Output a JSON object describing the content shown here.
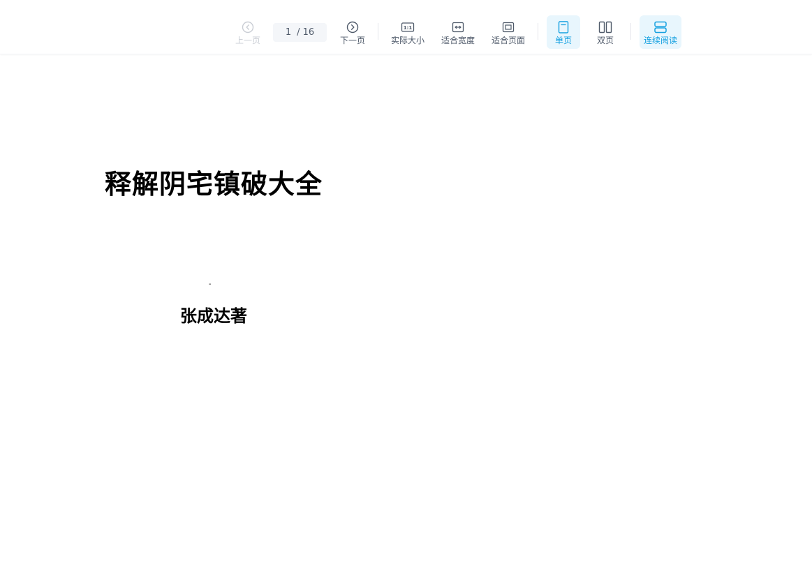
{
  "toolbar": {
    "prev_label": "上一页",
    "next_label": "下一页",
    "page_current": "1",
    "page_total": "/ 16",
    "actual_size_label": "实际大小",
    "fit_width_label": "适合宽度",
    "fit_page_label": "适合页面",
    "single_page_label": "单页",
    "double_page_label": "双页",
    "continuous_label": "连续阅读",
    "icons": {
      "prev": "chevron-left-circle-icon",
      "next": "chevron-right-circle-icon",
      "actual_size": "one-to-one-icon",
      "fit_width": "fit-width-icon",
      "fit_page": "fit-page-icon",
      "single_page": "single-page-icon",
      "double_page": "double-page-icon",
      "continuous": "continuous-scroll-icon"
    },
    "active_color": "#14a0e0",
    "active_bg": "#e8f6fd",
    "disabled_color": "#c9cdd4"
  },
  "document": {
    "title": "释解阴宅镇破大全",
    "mark": "-",
    "author": "张成达著"
  }
}
